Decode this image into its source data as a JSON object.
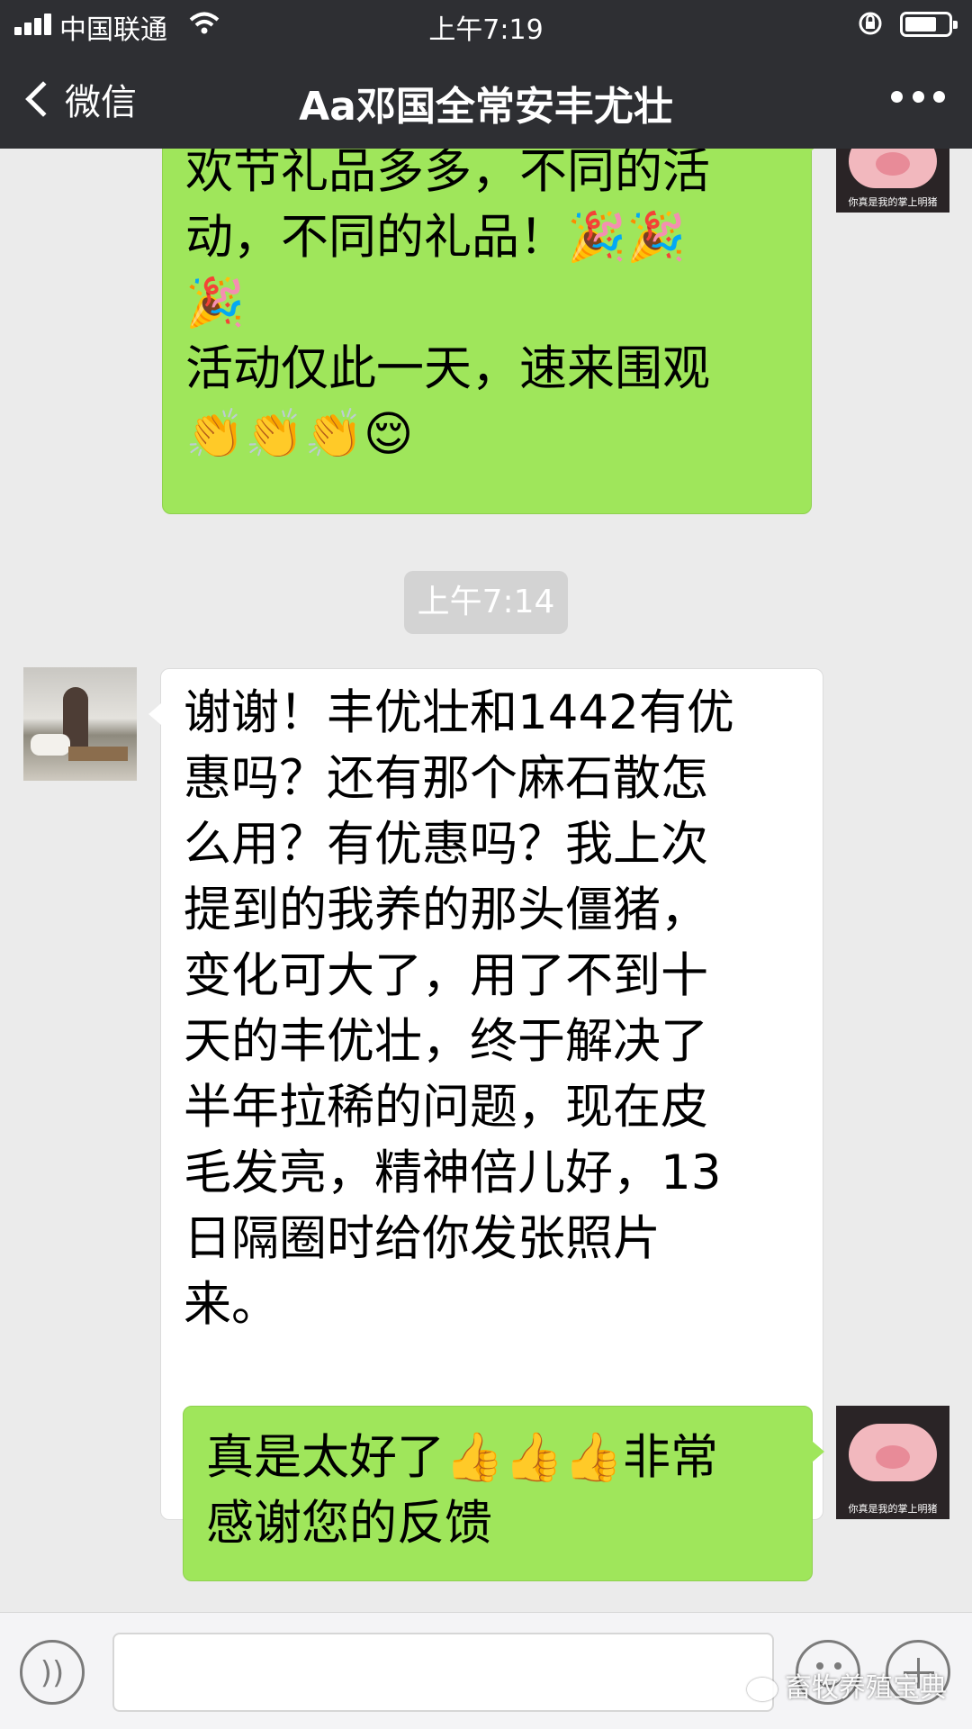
{
  "status_bar": {
    "carrier": "中国联通",
    "time": "上午7:19"
  },
  "nav": {
    "back_label": "微信",
    "title": "Aa邓国全常安丰尤壮"
  },
  "messages": [
    {
      "side": "right",
      "lines": [
        "欢节礼品多多，不同的活",
        "动，不同的礼品！🎉🎉",
        "🎉",
        "活动仅此一天，速来围观",
        "👏👏👏😌"
      ]
    },
    {
      "side": "left",
      "lines": [
        "谢谢！丰优壮和1442有优",
        "惠吗？还有那个麻石散怎",
        "么用？有优惠吗？我上次",
        "提到的我养的那头僵猪，",
        "变化可大了，用了不到十",
        "天的丰优壮，终于解决了",
        "半年拉稀的问题，现在皮",
        "毛发亮，精神倍儿好，13",
        "日隔圈时给你发张照片",
        "来。"
      ]
    },
    {
      "side": "right",
      "lines": [
        "真是太好了👍👍👍非常",
        "感谢您的反馈"
      ]
    }
  ],
  "timestamp": "上午7:14",
  "avatars": {
    "me_caption": "你真是我的掌上明猪"
  },
  "watermark": "畜牧养殖宝典",
  "icons": {
    "signal": "signal-icon",
    "wifi": "wifi-icon",
    "lock": "orientation-lock-icon",
    "battery": "battery-icon",
    "back": "chevron-left-icon",
    "more": "more-icon",
    "voice": "voice-icon",
    "emoji": "emoji-icon",
    "plus": "plus-icon"
  }
}
